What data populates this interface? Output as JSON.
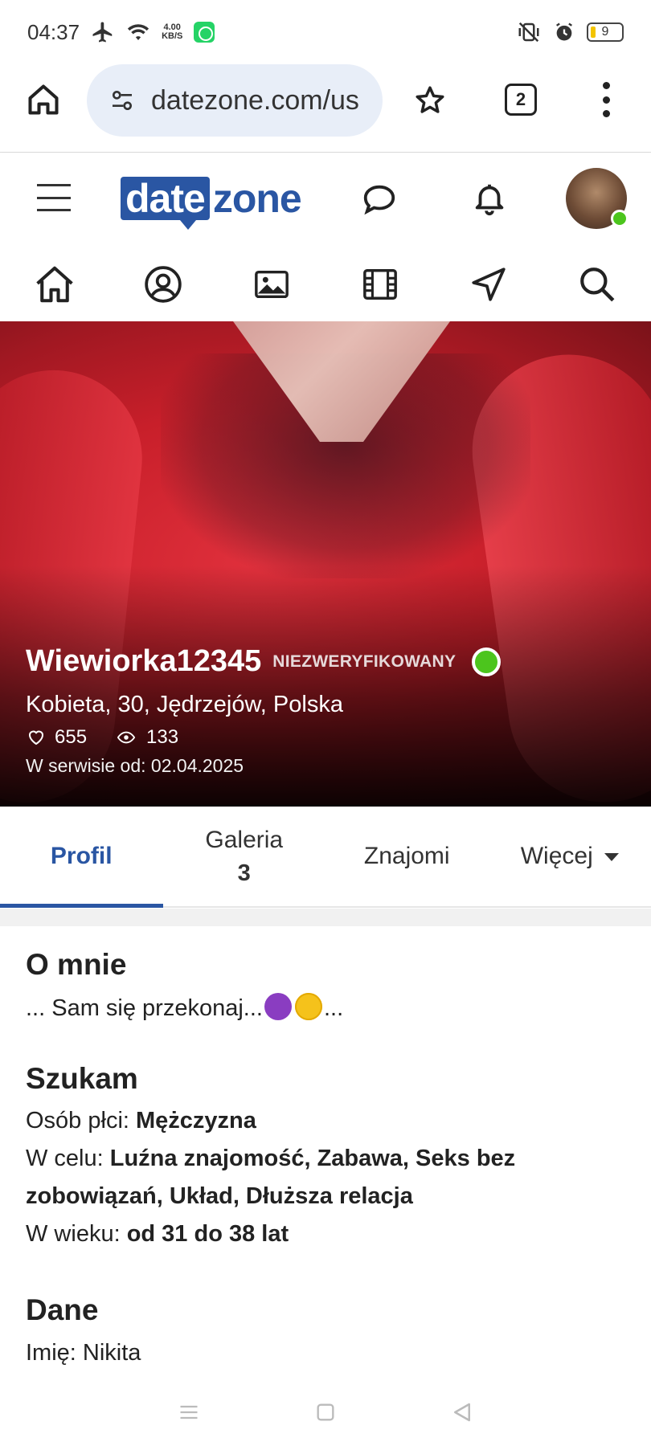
{
  "status": {
    "time": "04:37",
    "net_speed": "4.00",
    "net_unit": "KB/S",
    "battery": "9"
  },
  "browser": {
    "url": "datezone.com/us",
    "tab_count": "2"
  },
  "site": {
    "logo_part1": "date",
    "logo_part2": "zone"
  },
  "icon_nav": [
    "home-icon",
    "profile-icon",
    "photos-icon",
    "video-icon",
    "location-icon",
    "search-icon"
  ],
  "profile": {
    "username": "Wiewiorka12345",
    "verification": "NIEZWERYFIKOWANY",
    "details": "Kobieta, 30, Jędrzejów, Polska",
    "likes": "655",
    "views": "133",
    "member_since": "W serwisie od: 02.04.2025"
  },
  "tabs": {
    "profil": "Profil",
    "galeria": "Galeria",
    "galeria_count": "3",
    "znajomi": "Znajomi",
    "wiecej": "Więcej"
  },
  "about": {
    "title": "O mnie",
    "text_start": "... Sam się przekonaj...",
    "text_end": "..."
  },
  "seeking": {
    "title": "Szukam",
    "gender_label": "Osób płci: ",
    "gender_value": "Mężczyzna",
    "purpose_label": "W celu: ",
    "purpose_value": "Luźna znajomość, Zabawa, Seks bez zobowiązań, Układ, Dłuższa relacja",
    "age_label": "W wieku: ",
    "age_value": "od 31 do 38 lat"
  },
  "data_section": {
    "title": "Dane",
    "first_line_clipped": "Imię: Nikita"
  },
  "colors": {
    "brand": "#2a56a3",
    "online": "#4cc51d"
  }
}
